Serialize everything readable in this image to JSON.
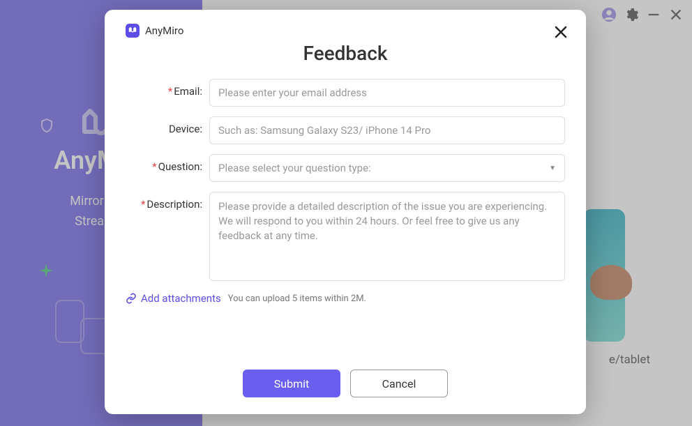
{
  "app": {
    "name": "AnyMiro"
  },
  "background": {
    "appName": "AnyMiro",
    "taglineLine1": "Mirror Your",
    "taglineLine2": "Stream w",
    "rightTabText": "e/tablet"
  },
  "modal": {
    "title": "Feedback",
    "fields": {
      "email": {
        "label": "Email:",
        "placeholder": "Please enter your email address",
        "required": true
      },
      "device": {
        "label": "Device:",
        "placeholder": "Such as: Samsung Galaxy S23/ iPhone 14 Pro",
        "required": false
      },
      "question": {
        "label": "Question:",
        "placeholder": "Please select your question type:",
        "required": true
      },
      "description": {
        "label": "Description:",
        "placeholder": "Please provide a detailed description of the issue you are experiencing. We will respond to you within 24 hours. Or feel free to give us any feedback at any time.",
        "required": true
      }
    },
    "attachments": {
      "linkText": "Add attachments",
      "hint": "You can upload 5 items within 2M."
    },
    "buttons": {
      "submit": "Submit",
      "cancel": "Cancel"
    }
  }
}
